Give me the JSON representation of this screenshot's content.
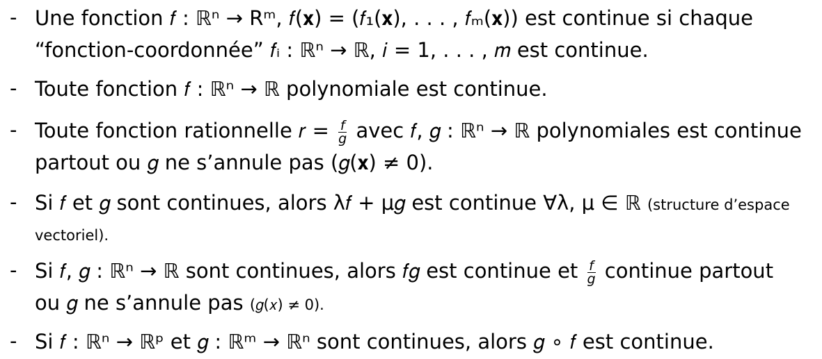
{
  "items": [
    {
      "dash": "-",
      "lines": [
        "Une fonction 𝑓 : ℝⁿ → Rᵐ, 𝑓(𝐱) = (𝑓₁(𝐱), . . . , 𝑓ₘ(𝐱)) est continue si chaque",
        "“fonction-coordonnée”  𝑓ᵢ : ℝⁿ → ℝ, 𝑖 = 1, . . . , 𝑚 est continue."
      ]
    },
    {
      "dash": "-",
      "lines": [
        "Toute fonction 𝑓 : ℝⁿ → ℝ polynomiale est continue."
      ]
    },
    {
      "dash": "-",
      "line1_before": "Toute fonction rationnelle 𝑟 =",
      "frac_num": "f",
      "frac_den": "g",
      "line1_after": "avec 𝑓, 𝑔 : ℝⁿ → ℝ polynomiales est continue",
      "line2": "partout ou 𝑔 ne s’annule pas (𝑔(𝐱) ≠ 0)."
    },
    {
      "dash": "-",
      "line1_main": "Si 𝑓 et 𝑔 sont continues, alors λ𝑓 + μ𝑔 est continue ∀λ, μ ∈ ℝ",
      "line1_small": "(structure d’espace",
      "line2_small": "vectoriel)."
    },
    {
      "dash": "-",
      "line1_before": "Si 𝑓, 𝑔 : ℝⁿ → ℝ sont continues, alors 𝑓𝑔 est continue et",
      "frac_num": "f",
      "frac_den": "g",
      "line1_after": "continue partout",
      "line2_main": "ou 𝑔 ne s’annule pas",
      "line2_small": "(𝑔(𝑥) ≠ 0)."
    },
    {
      "dash": "-",
      "lines": [
        "Si 𝑓 : ℝⁿ → ℝᵖ et 𝑔 : ℝᵐ → ℝⁿ sont continues, alors 𝑔 ∘ 𝑓 est continue."
      ]
    }
  ]
}
